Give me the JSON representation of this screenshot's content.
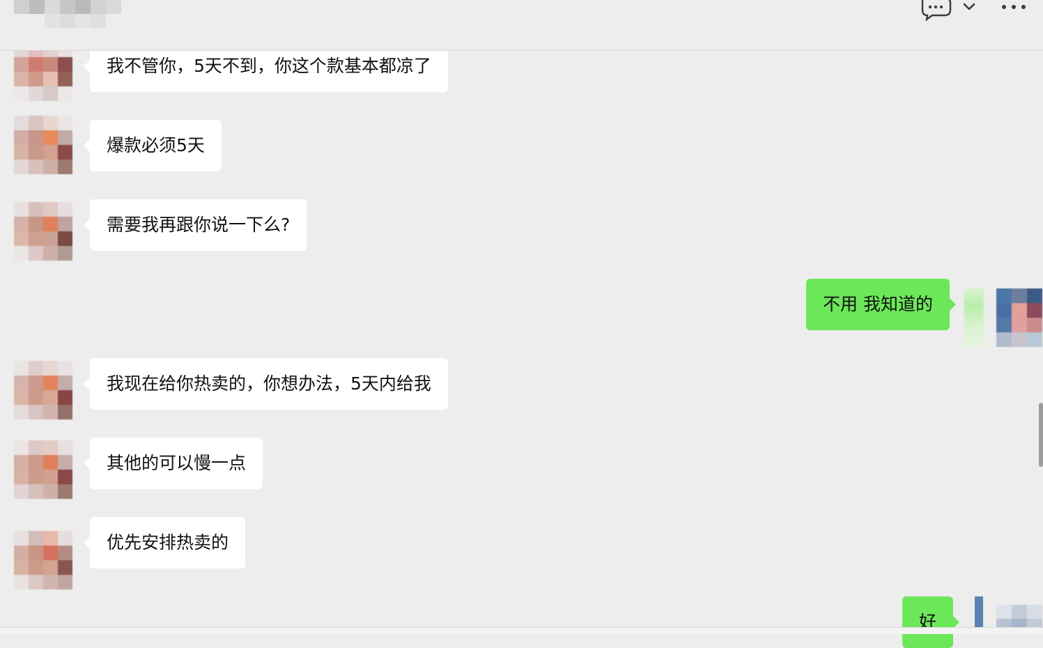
{
  "header": {
    "title": "",
    "icons": [
      "chat-bubble-icon",
      "chevron-down-icon",
      "more-icon"
    ]
  },
  "messages": [
    {
      "sender": "other",
      "text": "我不管你，5天不到，你这个款基本都凉了"
    },
    {
      "sender": "other",
      "text": "爆款必须5天"
    },
    {
      "sender": "other",
      "text": "需要我再跟你说一下么?"
    },
    {
      "sender": "me",
      "text": "不用 我知道的"
    },
    {
      "sender": "other",
      "text": "我现在给你热卖的，你想办法，5天内给我"
    },
    {
      "sender": "other",
      "text": "其他的可以慢一点"
    },
    {
      "sender": "other",
      "text": "优先安排热卖的"
    },
    {
      "sender": "me",
      "text": "好"
    }
  ],
  "colors": {
    "background": "#ededed",
    "incoming_bubble": "#ffffff",
    "outgoing_bubble": "#6de75a"
  }
}
